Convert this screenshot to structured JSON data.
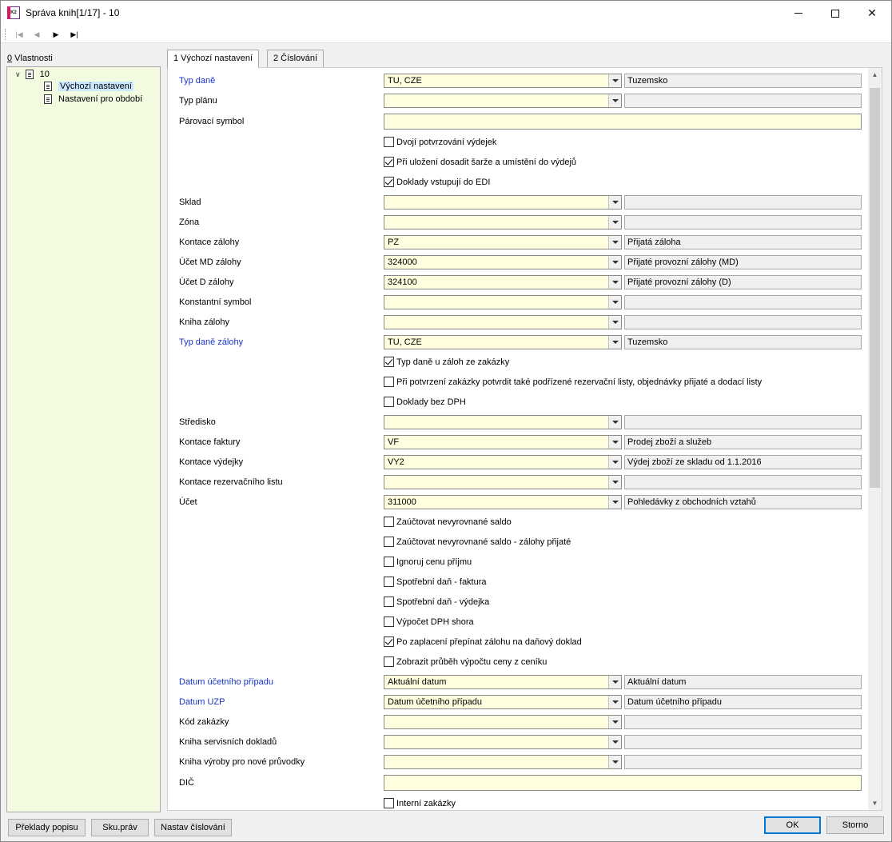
{
  "window": {
    "title": "Správa knih[1/17] - 10",
    "icon_text": "K2"
  },
  "toolbar": {
    "icons": [
      "first-record-icon",
      "prev-record-icon",
      "next-record-icon",
      "last-record-icon"
    ]
  },
  "left_panel": {
    "label_underlined": "0",
    "label_rest": " Vlastnosti",
    "tree_root": "10",
    "tree_items": [
      "Výchozí nastavení",
      "Nastavení pro období"
    ]
  },
  "tabs": [
    "1 Výchozí nastavení",
    "2 Číslování"
  ],
  "form": {
    "typ_dane": {
      "label": "Typ daně",
      "value": "TU, CZE",
      "desc": "Tuzemsko"
    },
    "typ_planu": {
      "label": "Typ plánu",
      "value": "",
      "desc": ""
    },
    "parovaci_symbol": {
      "label": "Párovací symbol",
      "value": ""
    },
    "dvoji_potvrzovani": {
      "label": "Dvojí potvrzování výdejek",
      "checked": false
    },
    "pri_ulozeni": {
      "label": "Při uložení dosadit šarže a umístění do výdejů",
      "checked": true
    },
    "doklady_edi": {
      "label": "Doklady vstupují do EDI",
      "checked": true
    },
    "sklad": {
      "label": "Sklad",
      "value": "",
      "desc": ""
    },
    "zona": {
      "label": "Zóna",
      "value": "",
      "desc": ""
    },
    "kontace_zalohy": {
      "label": "Kontace zálohy",
      "value": "PZ",
      "desc": "Přijatá záloha"
    },
    "ucet_md_zalohy": {
      "label": "Účet MD zálohy",
      "value": "324000",
      "desc": "Přijaté provozní zálohy (MD)"
    },
    "ucet_d_zalohy": {
      "label": "Účet D zálohy",
      "value": "324100",
      "desc": "Přijaté provozní zálohy (D)"
    },
    "konstantni_symbol": {
      "label": "Konstantní symbol",
      "value": "",
      "desc": ""
    },
    "kniha_zalohy": {
      "label": "Kniha zálohy",
      "value": "",
      "desc": ""
    },
    "typ_dane_zalohy": {
      "label": "Typ daně zálohy",
      "value": "TU, CZE",
      "desc": "Tuzemsko"
    },
    "typ_dane_zakazky": {
      "label": "Typ daně u záloh ze zakázky",
      "checked": true
    },
    "pri_potvrzeni": {
      "label": "Při potvrzení zakázky potvrdit také podřízené rezervační listy, objednávky přijaté a dodací listy",
      "checked": false
    },
    "doklady_bez_dph": {
      "label": "Doklady bez DPH",
      "checked": false
    },
    "stredisko": {
      "label": "Středisko",
      "value": "",
      "desc": ""
    },
    "kontace_faktury": {
      "label": "Kontace faktury",
      "value": "VF",
      "desc": "Prodej zboží a služeb"
    },
    "kontace_vydejky": {
      "label": "Kontace výdejky",
      "value": "VY2",
      "desc": "Výdej zboží ze skladu od 1.1.2016"
    },
    "kontace_rezervacniho": {
      "label": "Kontace rezervačního listu",
      "value": "",
      "desc": ""
    },
    "ucet": {
      "label": "Účet",
      "value": "311000",
      "desc": "Pohledávky z obchodních vztahů"
    },
    "zauctovat_saldo": {
      "label": "Zaúčtovat nevyrovnané saldo",
      "checked": false
    },
    "zauctovat_saldo_zalohy": {
      "label": "Zaúčtovat nevyrovnané saldo - zálohy přijaté",
      "checked": false
    },
    "ignoruj_cenu": {
      "label": "Ignoruj cenu příjmu",
      "checked": false
    },
    "spotrebni_faktura": {
      "label": "Spotřební daň - faktura",
      "checked": false
    },
    "spotrebni_vydejka": {
      "label": "Spotřební daň - výdejka",
      "checked": false
    },
    "vypocet_dph": {
      "label": "Výpočet DPH shora",
      "checked": false
    },
    "po_zaplaceni": {
      "label": "Po zaplacení přepínat zálohu na daňový doklad",
      "checked": true
    },
    "zobrazit_prubeh": {
      "label": "Zobrazit průběh výpočtu ceny z ceníku",
      "checked": false
    },
    "datum_uctu": {
      "label": "Datum účetního případu",
      "value": "Aktuální datum",
      "desc": "Aktuální datum"
    },
    "datum_uzp": {
      "label": "Datum UZP",
      "value": "Datum účetního případu",
      "desc": "Datum účetního případu"
    },
    "kod_zakazky": {
      "label": "Kód zakázky",
      "value": "",
      "desc": ""
    },
    "kniha_servisnich": {
      "label": "Kniha servisních dokladů",
      "value": "",
      "desc": ""
    },
    "kniha_vyroby": {
      "label": "Kniha výroby pro nové průvodky",
      "value": "",
      "desc": ""
    },
    "dic": {
      "label": "DIČ",
      "value": ""
    },
    "interni_zakazky": {
      "label": "Interní zakázky",
      "checked": false
    }
  },
  "buttons": {
    "preklady": "Překlady popisu",
    "sku_prav": "Sku.práv",
    "nastav_cislovani": "Nastav číslování",
    "ok": "OK",
    "storno": "Storno"
  },
  "colors": {
    "tree_bg": "#f2fbdf",
    "field_bg": "#ffffe0",
    "blue_label": "#1a33c7"
  }
}
